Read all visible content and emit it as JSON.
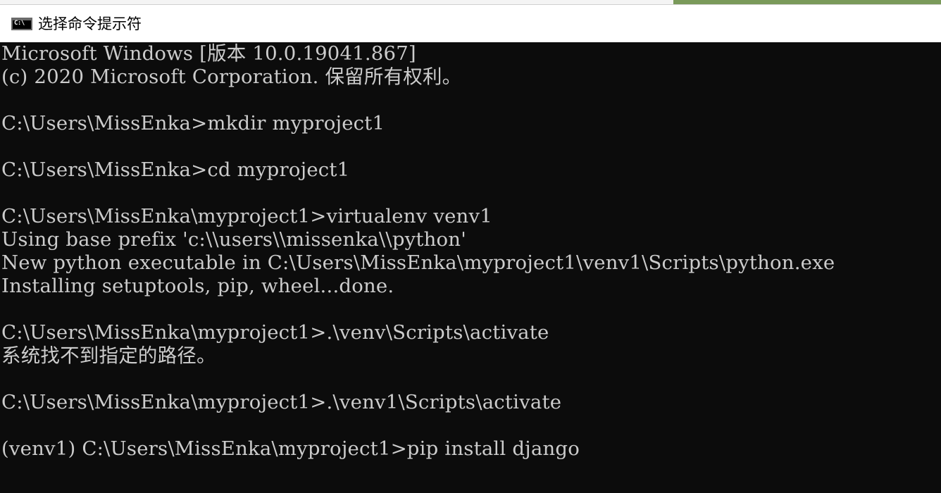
{
  "window": {
    "title": "选择命令提示符",
    "icon": "cmd-icon",
    "icon_text": "C:\\",
    "colors": {
      "console_background": "#0c0c0c",
      "console_text": "#cccccc",
      "titlebar_background": "#ffffff"
    }
  },
  "console": {
    "lines": [
      "Microsoft Windows [版本 10.0.19041.867]",
      "(c) 2020 Microsoft Corporation. 保留所有权利。",
      "",
      "C:\\Users\\MissEnka>mkdir myproject1",
      "",
      "C:\\Users\\MissEnka>cd myproject1",
      "",
      "C:\\Users\\MissEnka\\myproject1>virtualenv venv1",
      "Using base prefix 'c:\\\\users\\\\missenka\\\\python'",
      "New python executable in C:\\Users\\MissEnka\\myproject1\\venv1\\Scripts\\python.exe",
      "Installing setuptools, pip, wheel...done.",
      "",
      "C:\\Users\\MissEnka\\myproject1>.\\venv\\Scripts\\activate",
      "系统找不到指定的路径。",
      "",
      "C:\\Users\\MissEnka\\myproject1>.\\venv1\\Scripts\\activate",
      "",
      "(venv1) C:\\Users\\MissEnka\\myproject1>pip install django"
    ]
  }
}
